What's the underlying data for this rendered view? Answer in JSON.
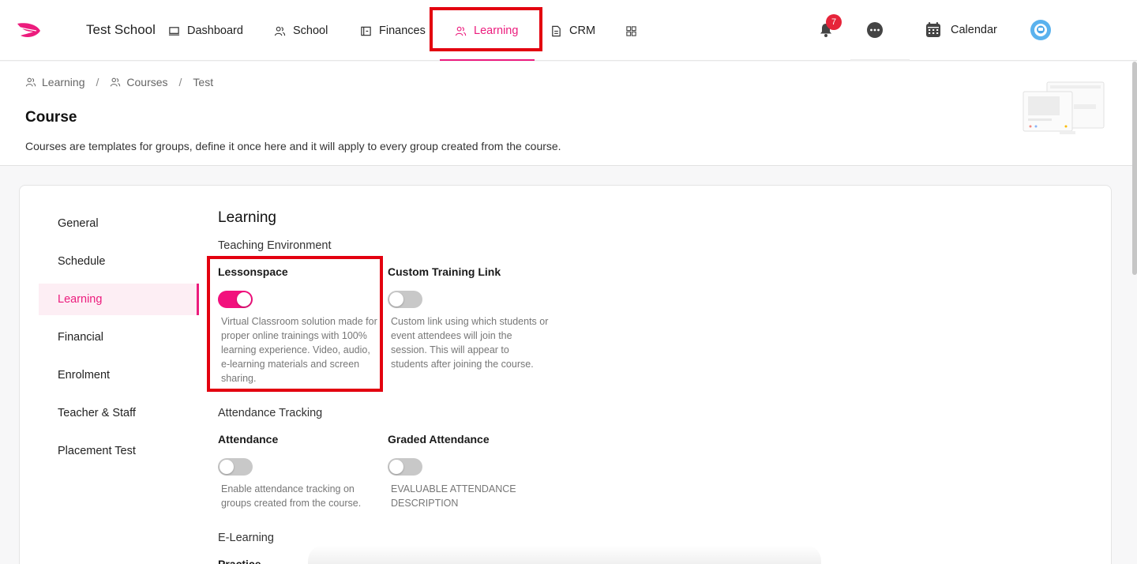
{
  "nav": {
    "school_name": "Test School",
    "items": [
      {
        "label": "Dashboard",
        "icon": "monitor-icon"
      },
      {
        "label": "School",
        "icon": "people-icon"
      },
      {
        "label": "Finances",
        "icon": "wallet-icon"
      },
      {
        "label": "Learning",
        "icon": "people-icon",
        "active": true
      },
      {
        "label": "CRM",
        "icon": "document-icon"
      }
    ],
    "notification_count": "7",
    "calendar_label": "Calendar",
    "accent_color": "#ec1c7d"
  },
  "breadcrumb": [
    "Learning",
    "Courses",
    "Test"
  ],
  "page": {
    "title": "Course",
    "description": "Courses are templates for groups, define it once here and it will apply to every group created from the course."
  },
  "sidebar": {
    "items": [
      {
        "label": "General"
      },
      {
        "label": "Schedule"
      },
      {
        "label": "Learning",
        "active": true
      },
      {
        "label": "Financial"
      },
      {
        "label": "Enrolment"
      },
      {
        "label": "Teacher & Staff"
      },
      {
        "label": "Placement Test"
      }
    ]
  },
  "content": {
    "section_title": "Learning",
    "teaching_environment": {
      "label": "Teaching Environment",
      "options": [
        {
          "title": "Lessonspace",
          "enabled": true,
          "description": "Virtual Classroom solution made for proper online trainings with 100% learning experience. Video, audio, e-learning materials and screen sharing."
        },
        {
          "title": "Custom Training Link",
          "enabled": false,
          "description": "Custom link using which students or event attendees will join the session. This will appear to students after joining the course."
        }
      ]
    },
    "attendance_tracking": {
      "label": "Attendance Tracking",
      "options": [
        {
          "title": "Attendance",
          "enabled": false,
          "description": "Enable attendance tracking on groups created from the course."
        },
        {
          "title": "Graded Attendance",
          "enabled": false,
          "description": "EVALUABLE ATTENDANCE DESCRIPTION"
        }
      ]
    },
    "e_learning": {
      "label": "E-Learning",
      "first_option_title": "Practice"
    }
  }
}
